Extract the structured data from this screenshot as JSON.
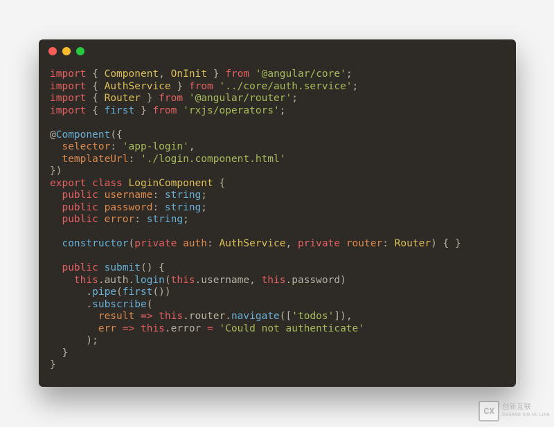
{
  "window": {
    "dots": {
      "red": "#ff5f56",
      "yellow": "#ffbd2e",
      "green": "#27c93f"
    }
  },
  "code": {
    "imp": "import",
    "from": "from",
    "Component": "Component",
    "OnInit": "OnInit",
    "AuthService": "AuthService",
    "Router": "Router",
    "first": "first",
    "path_core": "'@angular/core'",
    "path_auth_service": "'../core/auth.service'",
    "path_router": "'@angular/router'",
    "path_rxjs": "'rxjs/operators'",
    "at": "@",
    "selector_key": "selector",
    "selector_val": "'app-login'",
    "templateUrl_key": "templateUrl",
    "templateUrl_val": "'./login.component.html'",
    "export": "export",
    "class": "class",
    "LoginComponent": "LoginComponent",
    "public": "public",
    "private": "private",
    "username": "username",
    "password": "password",
    "error_prop": "error",
    "string": "string",
    "constructor": "constructor",
    "auth_param": "auth",
    "router_param": "router",
    "submit": "submit",
    "this": "this",
    "login": "login",
    "pipe": "pipe",
    "subscribe": "subscribe",
    "result": "result",
    "err": "err",
    "navigate": "navigate",
    "todos": "'todos'",
    "arrow": "=>",
    "eq": "=",
    "err_msg": "'Could not authenticate'"
  },
  "watermark": {
    "logo_text": "CX",
    "line1": "创新互联",
    "line2": "CHUANG XIN HU LIAN"
  }
}
